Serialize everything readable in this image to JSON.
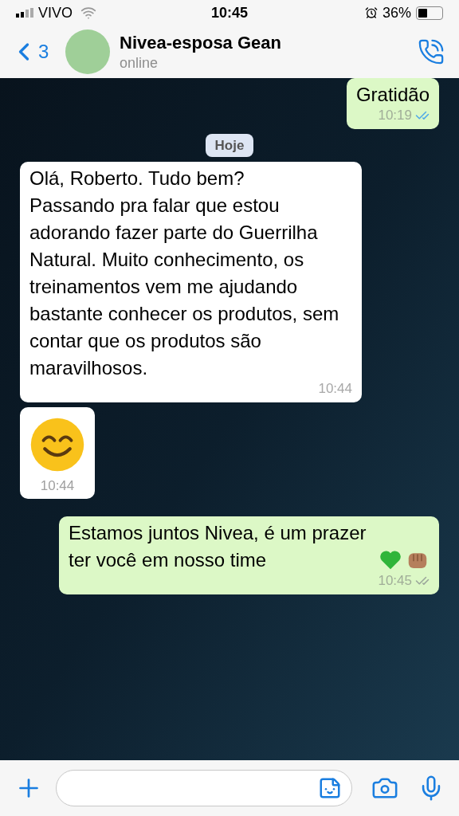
{
  "status_bar": {
    "carrier": "VIVO",
    "time": "10:45",
    "battery": "36%"
  },
  "header": {
    "back_count": "3",
    "contact_name": "Nivea-esposa Gean",
    "presence": "online"
  },
  "messages": [
    {
      "kind": "text",
      "outgoing": true,
      "text": "Gratidão",
      "time": "10:19",
      "read": true
    },
    {
      "kind": "date",
      "text": "Hoje"
    },
    {
      "kind": "text",
      "outgoing": false,
      "text": "Olá, Roberto. Tudo bem?\nPassando pra falar que estou adorando fazer parte do Guerrilha Natural. Muito conhecimento, os treinamentos vem me ajudando bastante conhecer os produtos, sem contar que os produtos são maravilhosos.",
      "time": "10:44"
    },
    {
      "kind": "emoji",
      "outgoing": false,
      "time": "10:44"
    },
    {
      "kind": "text",
      "outgoing": true,
      "text": "Estamos juntos Nivea, é um prazer ter você em nosso time",
      "emoji_tail": true,
      "time": "10:45",
      "read": false
    }
  ]
}
